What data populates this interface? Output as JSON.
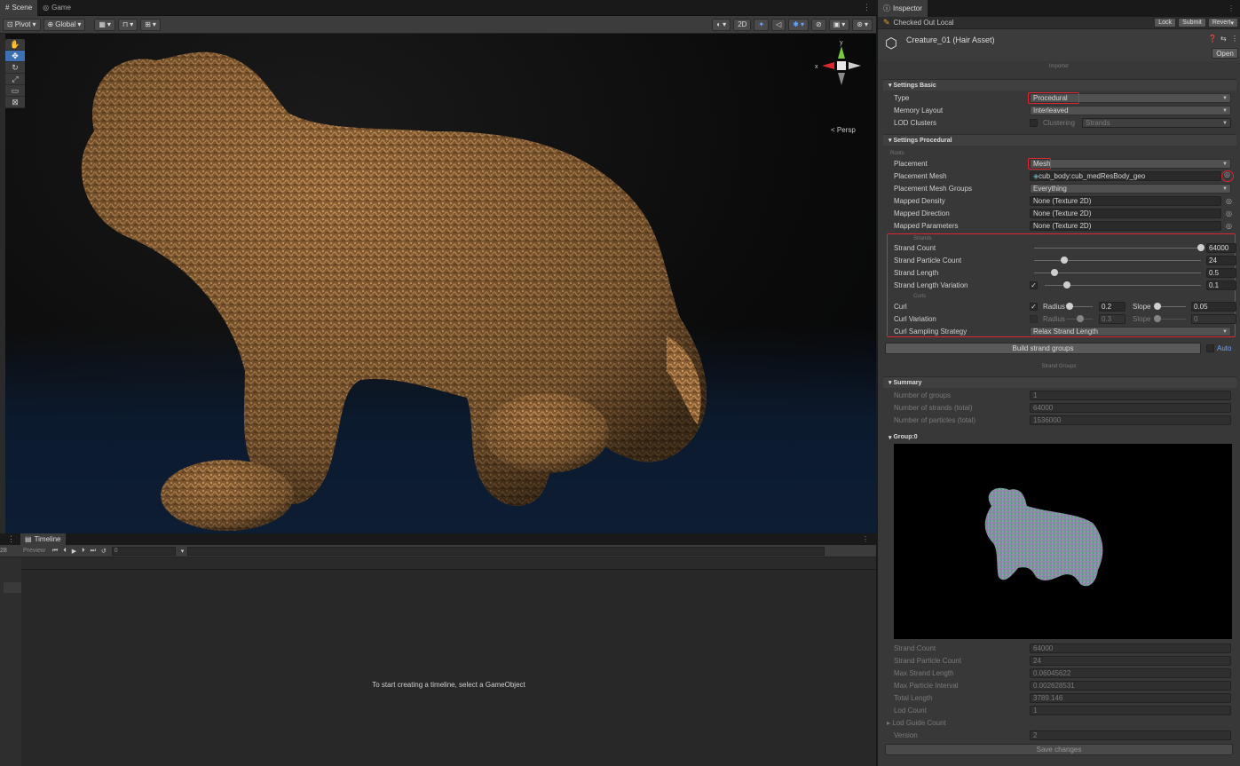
{
  "scene_tabs": {
    "scene": "Scene",
    "game": "Game"
  },
  "scene_toolbar": {
    "pivot": "Pivot",
    "global": "Global",
    "mode_2d": "2D"
  },
  "viewport": {
    "persp_label": "< Persp",
    "axis_y": "y",
    "axis_x": "x"
  },
  "timeline": {
    "tab": "Timeline",
    "preview": "Preview",
    "frame": "0",
    "left_num": "28",
    "message": "To start creating a timeline, select a GameObject"
  },
  "inspector": {
    "tab": "Inspector",
    "checked_out": "Checked Out Local",
    "lock": "Lock",
    "submit": "Submit",
    "revert": "Revert",
    "asset_title": "Creature_01 (Hair Asset)",
    "open": "Open",
    "importer": "Importer",
    "settings_basic": {
      "header": "Settings Basic",
      "type_label": "Type",
      "type_value": "Procedural",
      "memory_label": "Memory Layout",
      "memory_value": "Interleaved",
      "lod_label": "LOD Clusters",
      "clustering_label": "Clustering",
      "clustering_value": "Strands"
    },
    "settings_procedural": {
      "header": "Settings Procedural",
      "roots": "Roots",
      "placement_label": "Placement",
      "placement_value": "Mesh",
      "placement_mesh_label": "Placement Mesh",
      "placement_mesh_value": "cub_body:cub_medResBody_geo",
      "mesh_groups_label": "Placement Mesh Groups",
      "mesh_groups_value": "Everything",
      "mapped_density_label": "Mapped Density",
      "mapped_density_value": "None (Texture 2D)",
      "mapped_direction_label": "Mapped Direction",
      "mapped_direction_value": "None (Texture 2D)",
      "mapped_parameters_label": "Mapped Parameters",
      "mapped_parameters_value": "None (Texture 2D)",
      "strands": "Strands",
      "strand_count_label": "Strand Count",
      "strand_count_value": "64000",
      "strand_count_level": 1.0,
      "particle_count_label": "Strand Particle Count",
      "particle_count_value": "24",
      "particle_count_level": 0.18,
      "strand_length_label": "Strand Length",
      "strand_length_value": "0.5",
      "strand_length_level": 0.12,
      "length_variation_label": "Strand Length Variation",
      "length_variation_value": "0.1",
      "length_variation_level": 0.14,
      "curls": "Curls",
      "curl_label": "Curl",
      "radius_label": "Radius",
      "radius_value": "0.2",
      "slope_label": "Slope",
      "slope_value": "0.05",
      "curl_variation_label": "Curl Variation",
      "radius_var_value": "0.3",
      "slope_var_value": "0",
      "curl_sampling_label": "Curl Sampling Strategy",
      "curl_sampling_value": "Relax Strand Length"
    },
    "build_button": "Build strand groups",
    "auto_label": "Auto",
    "strand_groups": "Strand Groups",
    "summary": {
      "header": "Summary",
      "groups_label": "Number of groups",
      "groups_value": "1",
      "strands_label": "Number of strands (total)",
      "strands_value": "64000",
      "particles_label": "Number of particles (total)",
      "particles_value": "1536000"
    },
    "group0": {
      "header": "Group:0",
      "strand_count_label": "Strand Count",
      "strand_count_value": "64000",
      "particle_count_label": "Strand Particle Count",
      "particle_count_value": "24",
      "max_length_label": "Max Strand Length",
      "max_length_value": "0.06045622",
      "max_interval_label": "Max Particle Interval",
      "max_interval_value": "0.002628531",
      "total_length_label": "Total Length",
      "total_length_value": "3789.146",
      "lod_count_label": "Lod Count",
      "lod_count_value": "1",
      "lod_guide_label": "Lod Guide Count",
      "version_label": "Version",
      "version_value": "2"
    },
    "save_button": "Save changes"
  },
  "colors": {
    "accent": "#3d6fb3",
    "highlight_red": "#e0262e",
    "fur": "#9a6d3e",
    "panel": "#383838"
  }
}
